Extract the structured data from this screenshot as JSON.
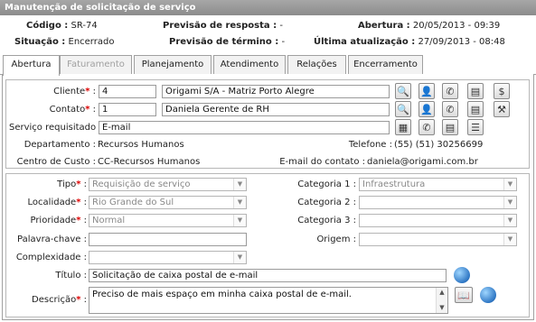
{
  "window": {
    "title": "Manutenção de solicitação de serviço"
  },
  "header": {
    "codigo_label": "Código :",
    "codigo_value": "SR-74",
    "situacao_label": "Situação :",
    "situacao_value": "Encerrado",
    "prev_resposta_label": "Previsão de resposta :",
    "prev_resposta_value": "-",
    "prev_termino_label": "Previsão de término :",
    "prev_termino_value": "-",
    "abertura_label": "Abertura :",
    "abertura_value": "20/05/2013 - 09:39",
    "ultima_label": "Última atualização :",
    "ultima_value": "27/09/2013 - 08:48"
  },
  "tabs": [
    {
      "label": "Abertura",
      "state": "active"
    },
    {
      "label": "Faturamento",
      "state": "disabled"
    },
    {
      "label": "Planejamento",
      "state": "normal"
    },
    {
      "label": "Atendimento",
      "state": "normal"
    },
    {
      "label": "Relações",
      "state": "normal"
    },
    {
      "label": "Encerramento",
      "state": "normal"
    }
  ],
  "cliente": {
    "label": "Cliente",
    "required": "*",
    "code": "4",
    "name": "Origami S/A - Matriz Porto Alegre"
  },
  "contato": {
    "label": "Contato",
    "required": "*",
    "code": "1",
    "name": "Daniela Gerente de RH"
  },
  "servico": {
    "label": "Serviço requisitado",
    "value": "E-mail"
  },
  "info": {
    "departamento_label": "Departamento :",
    "departamento_value": "Recursos Humanos",
    "telefone_label": "Telefone :",
    "telefone_value": "(55) (51) 30256699",
    "centro_label": "Centro de Custo :",
    "centro_value": "CC-Recursos Humanos",
    "email_label": "E-mail do contato :",
    "email_value": "daniela@origami.com.br"
  },
  "form": {
    "tipo": {
      "label": "Tipo",
      "required": "*",
      "value": "Requisição de serviço"
    },
    "localidade": {
      "label": "Localidade",
      "required": "*",
      "value": "Rio Grande do Sul"
    },
    "prioridade": {
      "label": "Prioridade",
      "required": "*",
      "value": "Normal"
    },
    "palavra_chave": {
      "label": "Palavra-chave :",
      "value": ""
    },
    "complexidade": {
      "label": "Complexidade :",
      "value": ""
    },
    "categoria1": {
      "label": "Categoria 1 :",
      "value": "Infraestrutura"
    },
    "categoria2": {
      "label": "Categoria 2 :",
      "value": ""
    },
    "categoria3": {
      "label": "Categoria 3 :",
      "value": ""
    },
    "origem": {
      "label": "Origem :",
      "value": ""
    },
    "titulo": {
      "label": "Título :",
      "value": "Solicitação de caixa postal de e-mail"
    },
    "descricao": {
      "label": "Descrição",
      "required": "*",
      "value": "Preciso de mais espaço em minha caixa postal de e-mail."
    }
  },
  "icons": {
    "search": "search-icon",
    "user": "user-icon",
    "phone": "phone-icon",
    "report": "report-icon",
    "money": "money-icon",
    "tools": "tools-icon",
    "calc": "calculator-icon",
    "list": "list-icon",
    "globe": "globe-icon",
    "book": "book-icon"
  },
  "colors": {
    "required": "#dd0000",
    "titlebar": "#9a9a9a"
  }
}
